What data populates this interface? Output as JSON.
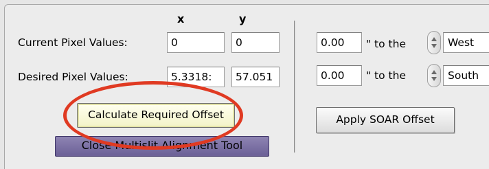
{
  "headers": {
    "x": "x",
    "y": "y"
  },
  "current": {
    "label": "Current Pixel Values:",
    "x": "0",
    "y": "0"
  },
  "desired": {
    "label": "Desired Pixel Values:",
    "x": "5.3318:",
    "y": "57.051"
  },
  "buttons": {
    "calculate": "Calculate Required Offset",
    "close": "Close Multislit Alignment Tool",
    "apply": "Apply SOAR Offset"
  },
  "offsets": [
    {
      "value": "0.00",
      "suffix": "\" to the",
      "direction": "West"
    },
    {
      "value": "0.00",
      "suffix": "\" to the",
      "direction": "South"
    }
  ],
  "colors": {
    "highlight_ring": "#e03a22",
    "calculate_button": "#f6f6d0",
    "close_button": "#7b6fa6"
  }
}
